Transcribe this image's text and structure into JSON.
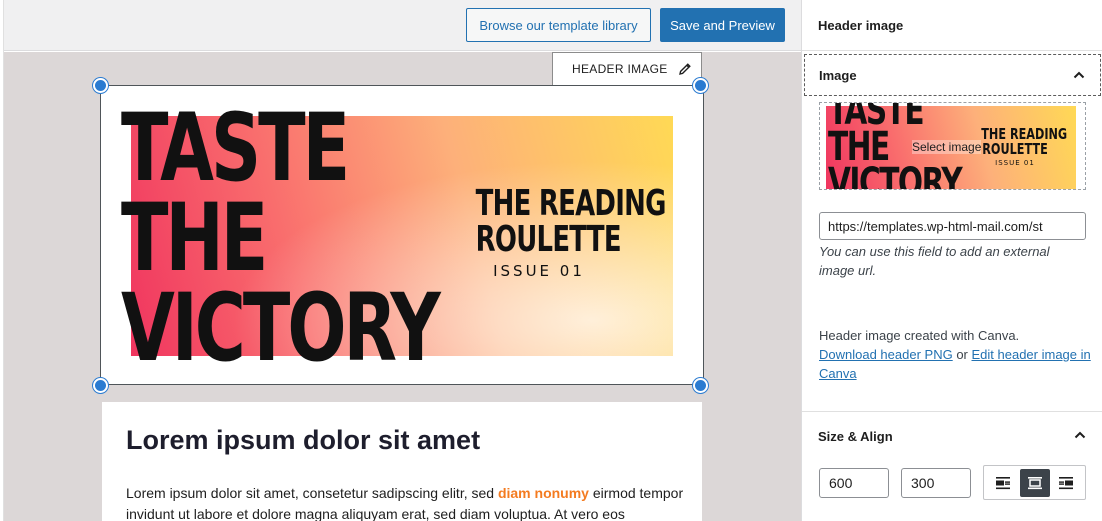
{
  "toolbar": {
    "browse_label": "Browse our template library",
    "save_preview_label": "Save and Preview"
  },
  "canvas": {
    "block_tab_label": "HEADER IMAGE",
    "banner": {
      "taste_text": "TASTE\nTHE\nVICTORY",
      "reading_line1": "THE READING",
      "reading_line2": "ROULETTE",
      "issue": "ISSUE 01"
    },
    "content": {
      "title": "Lorem ipsum dolor sit amet",
      "body_before": "Lorem ipsum dolor sit amet, consetetur sadipscing elitr, sed ",
      "body_highlight": "diam nonumy",
      "body_after": " eirmod tempor invidunt ut labore et dolore magna aliquyam erat, sed diam voluptua. At vero eos"
    }
  },
  "sidebar": {
    "title": "Header image",
    "image_panel": {
      "title": "Image",
      "select_label": "Select image",
      "url_value": "https://templates.wp-html-mail.com/st",
      "help": "You can use this field to add an external image url.",
      "canva_note": "Header image created with Canva.",
      "download_link": "Download header PNG",
      "or_text": " or ",
      "edit_link": "Edit header image in Canva"
    },
    "size_panel": {
      "title": "Size & Align",
      "width": "600",
      "height": "300"
    }
  },
  "colors": {
    "accent": "#2271b1",
    "handle": "#2a7bd1",
    "highlight": "#f47b20"
  }
}
